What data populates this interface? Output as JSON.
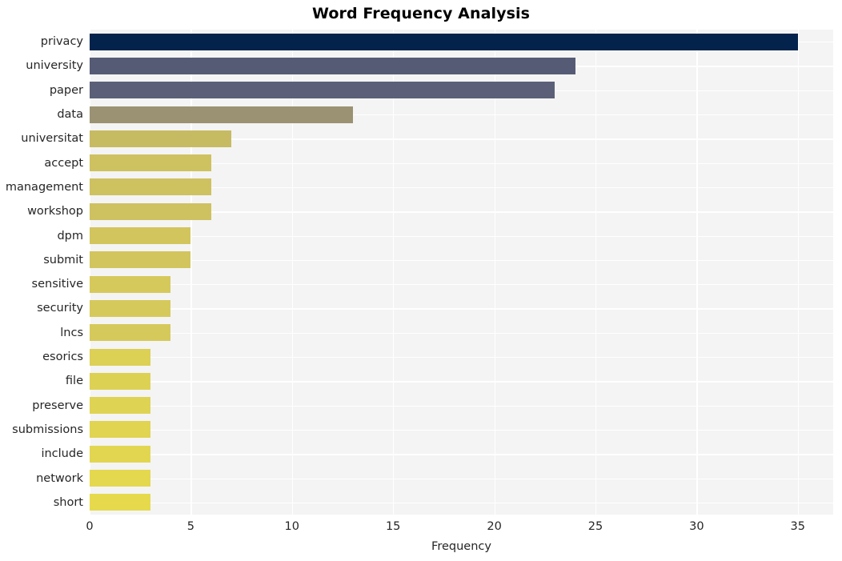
{
  "chart_data": {
    "type": "bar",
    "orientation": "horizontal",
    "title": "Word Frequency Analysis",
    "xlabel": "Frequency",
    "ylabel": "",
    "xlim": [
      0,
      36.75
    ],
    "xticks": [
      0,
      5,
      10,
      15,
      20,
      25,
      30,
      35
    ],
    "xtick_labels": [
      "0",
      "5",
      "10",
      "15",
      "20",
      "25",
      "30",
      "35"
    ],
    "grid": true,
    "legend": null,
    "categories": [
      "privacy",
      "university",
      "paper",
      "data",
      "universitat",
      "accept",
      "management",
      "workshop",
      "dpm",
      "submit",
      "sensitive",
      "security",
      "lncs",
      "esorics",
      "file",
      "preserve",
      "submissions",
      "include",
      "network",
      "short"
    ],
    "values": [
      35,
      24,
      23,
      13,
      7,
      6,
      6,
      6,
      5,
      5,
      4,
      4,
      4,
      3,
      3,
      3,
      3,
      3,
      3,
      3
    ],
    "bar_colors": [
      "#04234c",
      "#565b75",
      "#5b6078",
      "#9a9273",
      "#c6bb63",
      "#cec160",
      "#cec160",
      "#cec160",
      "#d2c55d",
      "#d2c55d",
      "#d6c95b",
      "#d6c95b",
      "#d6c95b",
      "#dcd055",
      "#ddd154",
      "#dfd353",
      "#e0d451",
      "#e2d650",
      "#e4d84e",
      "#e6da4c"
    ],
    "plot_background": "#f4f4f4",
    "grid_color": "#ffffff",
    "figure_background": "#ffffff",
    "tick_label_color": "#262626"
  }
}
